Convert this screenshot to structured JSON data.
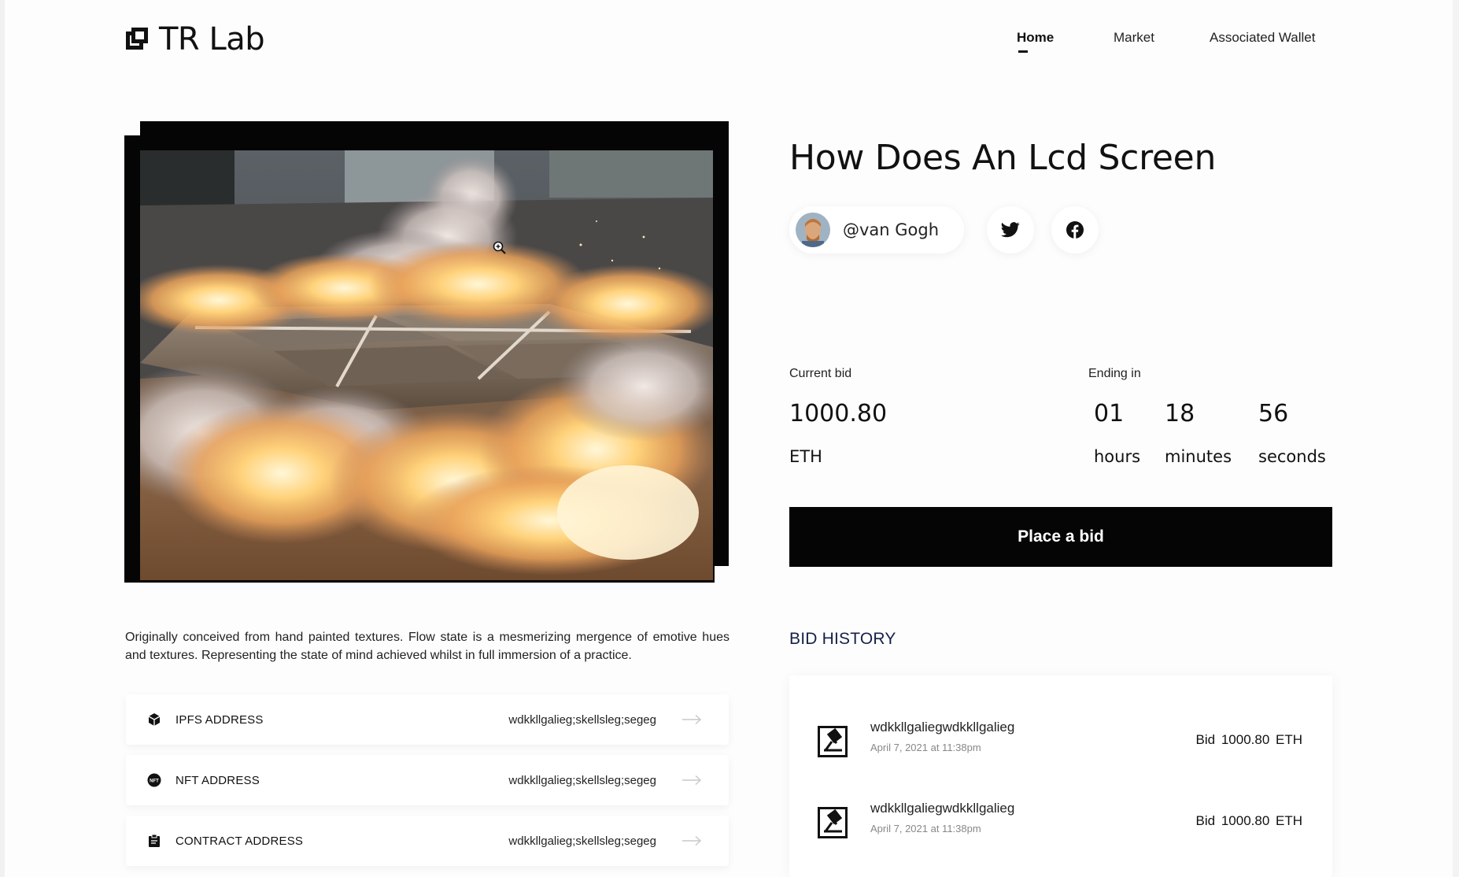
{
  "header": {
    "logo_text": "TR Lab",
    "nav": [
      {
        "label": "Home",
        "active": true
      },
      {
        "label": "Market",
        "active": false
      },
      {
        "label": "Associated Wallet",
        "active": false
      }
    ]
  },
  "artwork": {
    "description": "Originally conceived from hand painted textures. Flow state is a mesmerizing mergence of emotive hues and textures. Representing the state of mind achieved whilst in full immersion of a practice."
  },
  "addresses": [
    {
      "label": "IPFS ADDRESS",
      "value": "wdkkllgalieg;skellsleg;segeg",
      "icon": "cube-icon"
    },
    {
      "label": "NFT ADDRESS",
      "value": "wdkkllgalieg;skellsleg;segeg",
      "icon": "nft-badge-icon"
    },
    {
      "label": "CONTRACT ADDRESS",
      "value": "wdkkllgalieg;skellsleg;segeg",
      "icon": "clipboard-icon"
    }
  ],
  "item": {
    "title": "How Does An Lcd Screen",
    "creator": "@van Gogh"
  },
  "auction": {
    "current_bid_label": "Current bid",
    "current_bid_value": "1000.80",
    "current_bid_unit": "ETH",
    "ending_label": "Ending in",
    "hours": "01",
    "hours_label": "hours",
    "minutes": "18",
    "minutes_label": "minutes",
    "seconds": "56",
    "seconds_label": "seconds",
    "bid_button": "Place a bid"
  },
  "bid_history": {
    "title": "BID HISTORY",
    "rows": [
      {
        "name": "wdkkllgaliegwdkkllgalieg",
        "date": "April 7, 2021 at 11:38pm",
        "bid": "Bid  1000.80  ETH"
      },
      {
        "name": "wdkkllgaliegwdkkllgalieg",
        "date": "April 7, 2021 at 11:38pm",
        "bid": "Bid  1000.80  ETH"
      }
    ]
  },
  "colors": {
    "accent": "#050505",
    "history_title": "#15204a",
    "background": "#fdfdfd"
  }
}
